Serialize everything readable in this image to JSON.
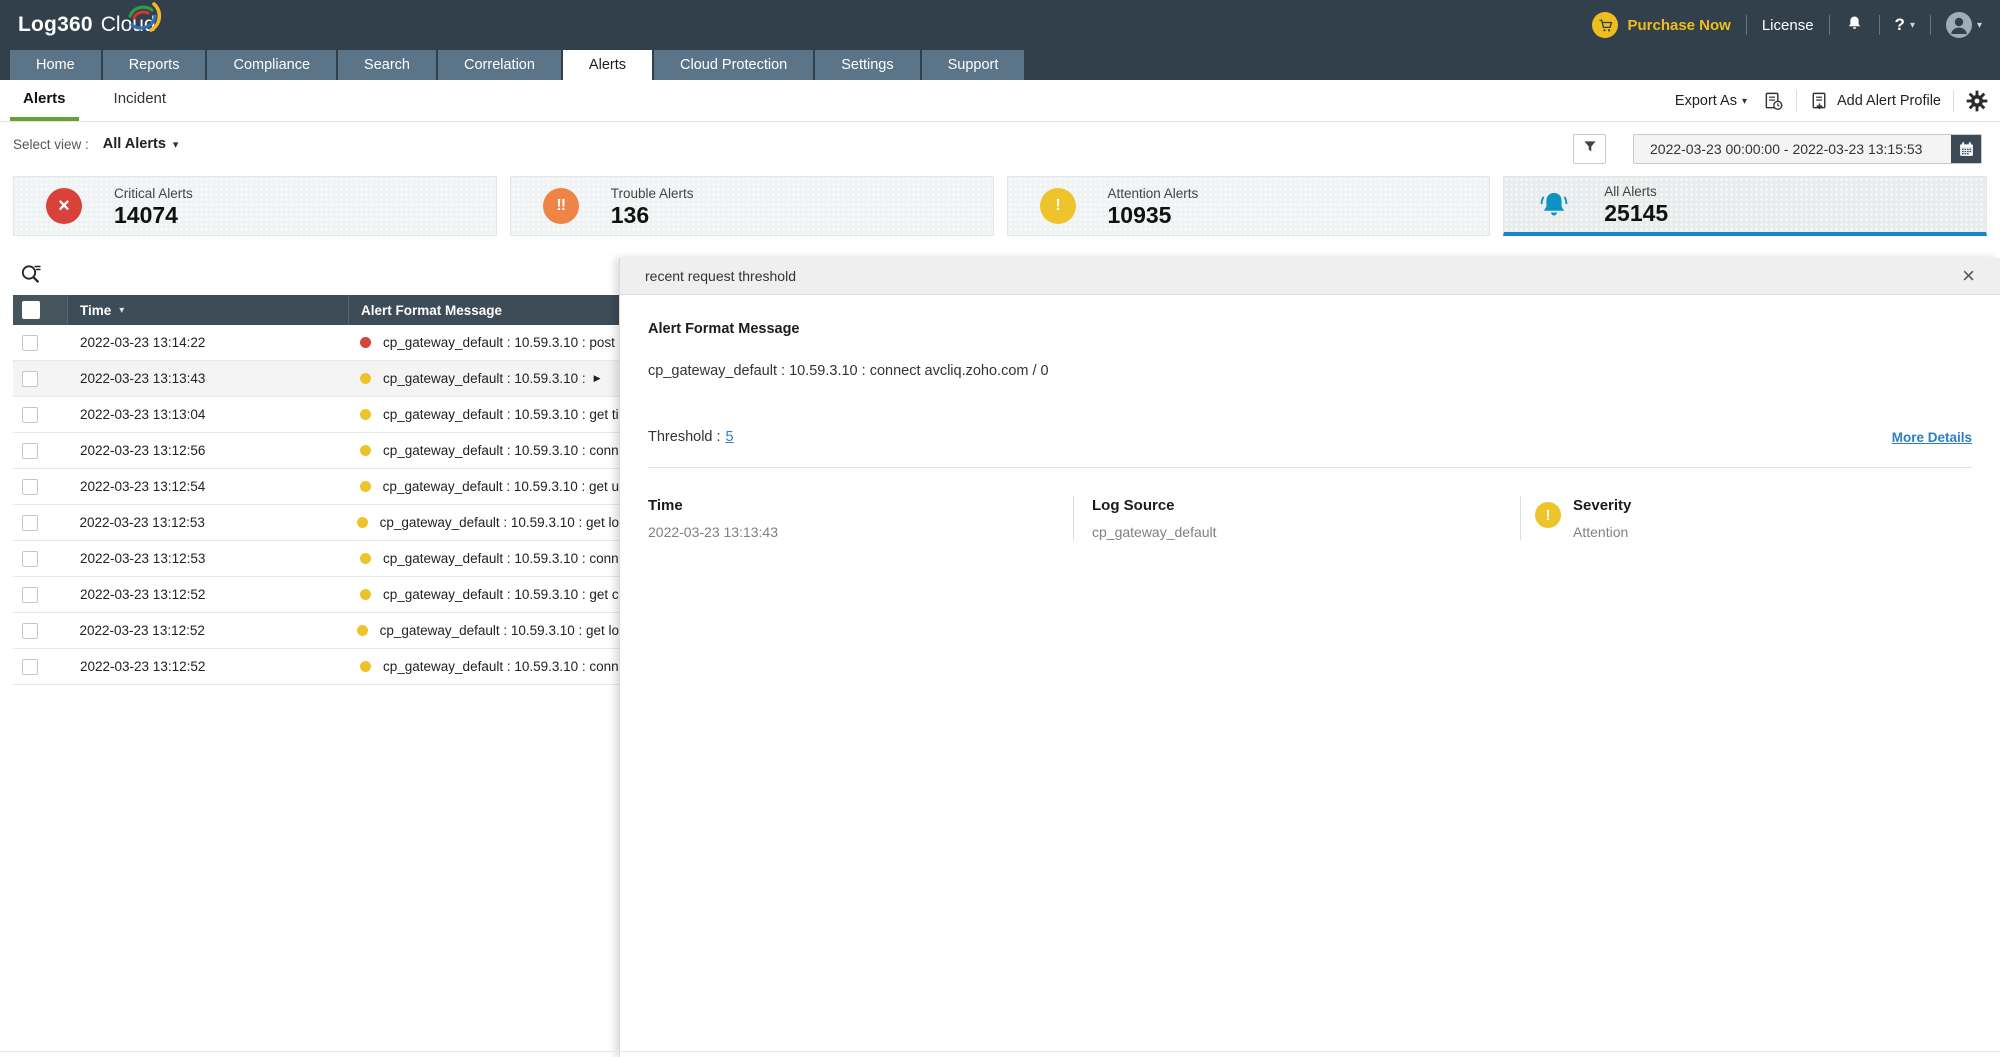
{
  "header": {
    "logo_bold": "Log360",
    "logo_light": "Cloud",
    "purchase_now": "Purchase Now",
    "license": "License",
    "help": "?"
  },
  "nav": {
    "tabs": [
      {
        "label": "Home"
      },
      {
        "label": "Reports"
      },
      {
        "label": "Compliance"
      },
      {
        "label": "Search"
      },
      {
        "label": "Correlation"
      },
      {
        "label": "Alerts"
      },
      {
        "label": "Cloud Protection"
      },
      {
        "label": "Settings"
      },
      {
        "label": "Support"
      }
    ],
    "active": "Alerts"
  },
  "subnav": {
    "tabs": [
      {
        "label": "Alerts"
      },
      {
        "label": "Incident"
      }
    ],
    "active": "Alerts",
    "export_as": "Export As",
    "add_alert_profile": "Add Alert Profile"
  },
  "toolbar": {
    "select_view_label": "Select view :",
    "view_value": "All Alerts",
    "date_range": "2022-03-23 00:00:00 - 2022-03-23 13:15:53"
  },
  "cards": [
    {
      "label": "Critical Alerts",
      "value": "14074",
      "color": "#d8423a"
    },
    {
      "label": "Trouble Alerts",
      "value": "136",
      "color": "#ee8445"
    },
    {
      "label": "Attention Alerts",
      "value": "10935",
      "color": "#efc32b"
    },
    {
      "label": "All Alerts",
      "value": "25145",
      "color": "#0d93c3",
      "selected": true
    }
  ],
  "table": {
    "columns": {
      "time": "Time",
      "message": "Alert Format Message"
    },
    "rows": [
      {
        "time": "2022-03-23 13:14:22",
        "color": "#d8423a",
        "message": "cp_gateway_default : 10.59.3.10 : post"
      },
      {
        "time": "2022-03-23 13:13:43",
        "color": "#eec32a",
        "message": "cp_gateway_default : 10.59.3.10 :",
        "selected": true
      },
      {
        "time": "2022-03-23 13:13:04",
        "color": "#eec32a",
        "message": "cp_gateway_default : 10.59.3.10 : get ti"
      },
      {
        "time": "2022-03-23 13:12:56",
        "color": "#eec32a",
        "message": "cp_gateway_default : 10.59.3.10 : conn"
      },
      {
        "time": "2022-03-23 13:12:54",
        "color": "#eec32a",
        "message": "cp_gateway_default : 10.59.3.10 : get u"
      },
      {
        "time": "2022-03-23 13:12:53",
        "color": "#eec32a",
        "message": "cp_gateway_default : 10.59.3.10 : get lo"
      },
      {
        "time": "2022-03-23 13:12:53",
        "color": "#eec32a",
        "message": "cp_gateway_default : 10.59.3.10 : conn"
      },
      {
        "time": "2022-03-23 13:12:52",
        "color": "#eec32a",
        "message": "cp_gateway_default : 10.59.3.10 : get c"
      },
      {
        "time": "2022-03-23 13:12:52",
        "color": "#eec32a",
        "message": "cp_gateway_default : 10.59.3.10 : get lo"
      },
      {
        "time": "2022-03-23 13:12:52",
        "color": "#eec32a",
        "message": "cp_gateway_default : 10.59.3.10 : conn"
      }
    ]
  },
  "detail": {
    "title": "recent request threshold",
    "message_heading": "Alert Format Message",
    "message": "cp_gateway_default : 10.59.3.10 : connect avcliq.zoho.com / 0",
    "threshold_label": "Threshold :",
    "threshold_value": "5",
    "more_details": "More Details",
    "severity_color": "#efc32b",
    "fields": [
      {
        "label": "Time",
        "value": "2022-03-23 13:13:43"
      },
      {
        "label": "Log Source",
        "value": "cp_gateway_default"
      },
      {
        "label": "Severity",
        "value": "Attention"
      }
    ]
  },
  "icons": {
    "chevron_down": "▾",
    "arrow_right": "▶",
    "close": "×",
    "critical_glyph": "×",
    "trouble_glyph": "!!",
    "attention_glyph": "!"
  },
  "colors": {
    "accent_blue": "#1588c9",
    "active_tab_green": "#64a233",
    "link_blue": "#2d7fc1",
    "header_dark": "#31404b",
    "nav_tab": "#5b7487"
  }
}
